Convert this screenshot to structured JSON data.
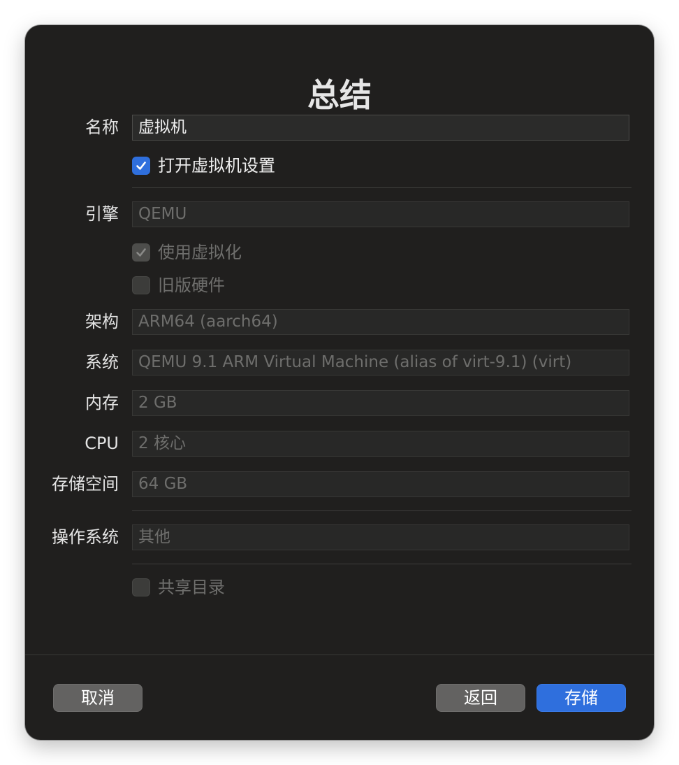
{
  "dialog": {
    "title": "总结"
  },
  "name_row": {
    "label": "名称",
    "value": "虚拟机"
  },
  "open_settings": {
    "label": "打开虚拟机设置",
    "checked": true
  },
  "engine_row": {
    "label": "引擎",
    "value": "QEMU"
  },
  "use_virtualization": {
    "label": "使用虚拟化",
    "checked": true
  },
  "legacy_hardware": {
    "label": "旧版硬件",
    "checked": false
  },
  "arch_row": {
    "label": "架构",
    "value": "ARM64 (aarch64)"
  },
  "system_row": {
    "label": "系统",
    "value": "QEMU 9.1 ARM Virtual Machine (alias of virt-9.1) (virt)"
  },
  "memory_row": {
    "label": "内存",
    "value": "2 GB"
  },
  "cpu_row": {
    "label": "CPU",
    "value": "2 核心"
  },
  "storage_row": {
    "label": "存储空间",
    "value": "64 GB"
  },
  "os_row": {
    "label": "操作系统",
    "value": "其他"
  },
  "shared_dir": {
    "label": "共享目录",
    "checked": false
  },
  "buttons": {
    "cancel": "取消",
    "back": "返回",
    "save": "存储"
  },
  "colors": {
    "accent": "#2f6fdd",
    "background": "#201f1e"
  },
  "icons": {
    "checkmark": "checkmark-icon"
  }
}
